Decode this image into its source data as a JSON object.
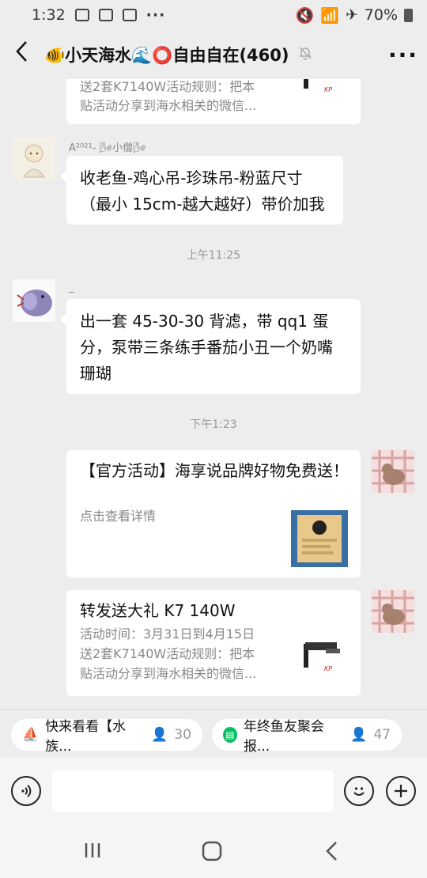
{
  "status_bar": {
    "time": "1:32",
    "battery": "70%"
  },
  "header": {
    "title": "🐠小天海水🌊⭕自由自在(460)",
    "back_icon": "chevron-left-icon",
    "more_label": "···"
  },
  "messages": {
    "top_card": {
      "line1": "送2套K7140W活动规则：把本",
      "line2": "贴活动分享到海水相关的微信..."
    },
    "msg1": {
      "sender": "A²⁰²¹- 🌬小僧🌬",
      "text": "收老鱼-鸡心吊-珍珠吊-粉蓝尺寸（最小 15cm-越大越好）带价加我"
    },
    "time1": "上午11:25",
    "msg2": {
      "sender": "_",
      "text": "出一套 45-30-30 背滤，带 qq1 蛋分，泵带三条练手番茄小丑一个奶嘴珊瑚"
    },
    "time2": "下午1:23",
    "card1": {
      "title": "【官方活动】海享说品牌好物免费送！",
      "desc": "点击查看详情"
    },
    "card2": {
      "title": "转发送大礼 K7 140W",
      "line1": "活动时间：3月31日到4月15日",
      "line2": "送2套K7140W活动规则：把本",
      "line3": "贴活动分享到海水相关的微信..."
    }
  },
  "quick_bar": {
    "item1": {
      "label": "快来看看【水族...",
      "count": "30"
    },
    "item2": {
      "label": "年终鱼友聚会报...",
      "count": "47"
    }
  },
  "colors": {
    "bg": "#ededed",
    "bubble": "#ffffff",
    "accent_green": "#07c160"
  }
}
